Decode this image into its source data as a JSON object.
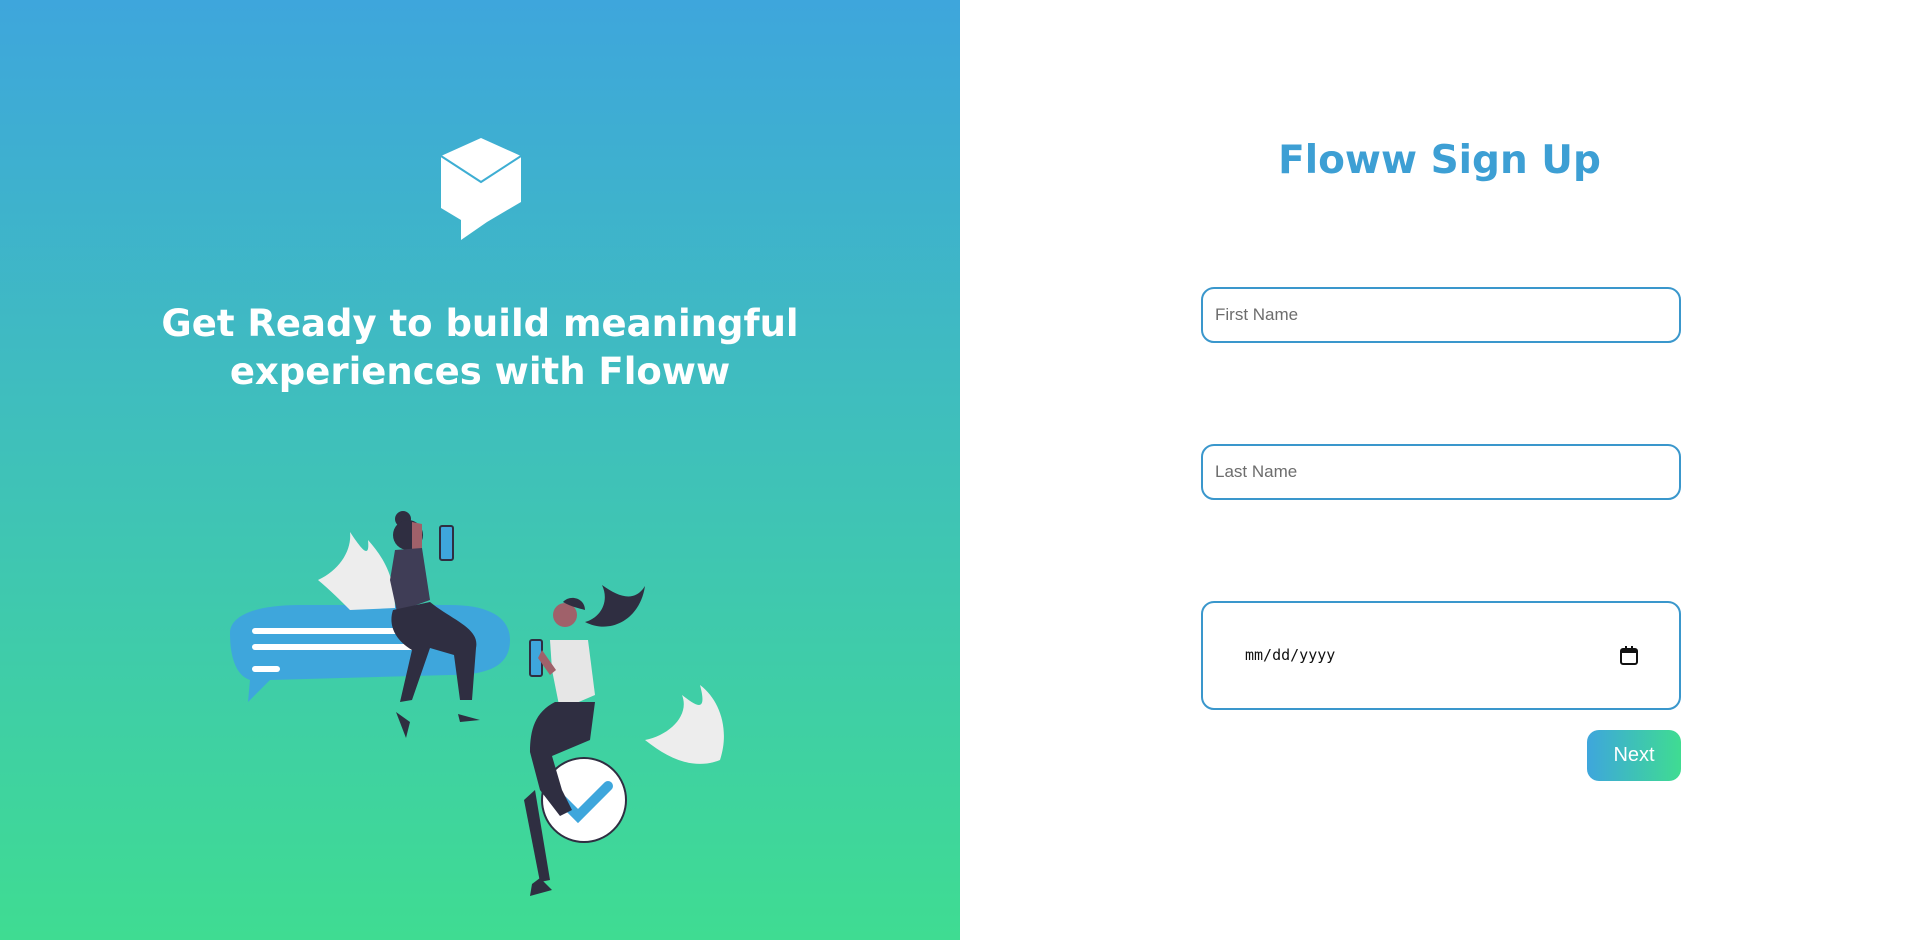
{
  "hero": {
    "tagline_line1": "Get Ready to build meaningful",
    "tagline_line2": "experiences with Floww",
    "logo_icon": "cube-chat-icon",
    "illustration": "people-chatting-illustration"
  },
  "form": {
    "title": "Floww Sign Up",
    "first_name_placeholder": "First Name",
    "last_name_placeholder": "Last Name",
    "date_placeholder": "mm/dd/yyyy",
    "calendar_icon": "calendar-icon",
    "next_label": "Next"
  },
  "colors": {
    "gradient_top": "#3ea6dc",
    "gradient_bottom": "#3fdc92",
    "accent": "#3d9fd4",
    "bubble_blue": "#3ea6dc",
    "figure_dark": "#2f2e41"
  }
}
